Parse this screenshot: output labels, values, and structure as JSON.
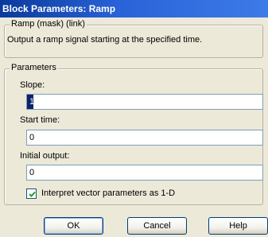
{
  "window": {
    "title": "Block Parameters: Ramp"
  },
  "mask_group": {
    "legend": "Ramp (mask) (link)",
    "description": "Output a ramp signal starting at the specified time."
  },
  "params_group": {
    "legend": "Parameters",
    "fields": [
      {
        "label": "Slope:",
        "value": "1"
      },
      {
        "label": "Start time:",
        "value": "0"
      },
      {
        "label": "Initial output:",
        "value": "0"
      }
    ],
    "checkbox": {
      "label": "Interpret vector parameters as 1-D",
      "checked": true
    }
  },
  "buttons": {
    "ok": "OK",
    "cancel": "Cancel",
    "help": "Help"
  }
}
